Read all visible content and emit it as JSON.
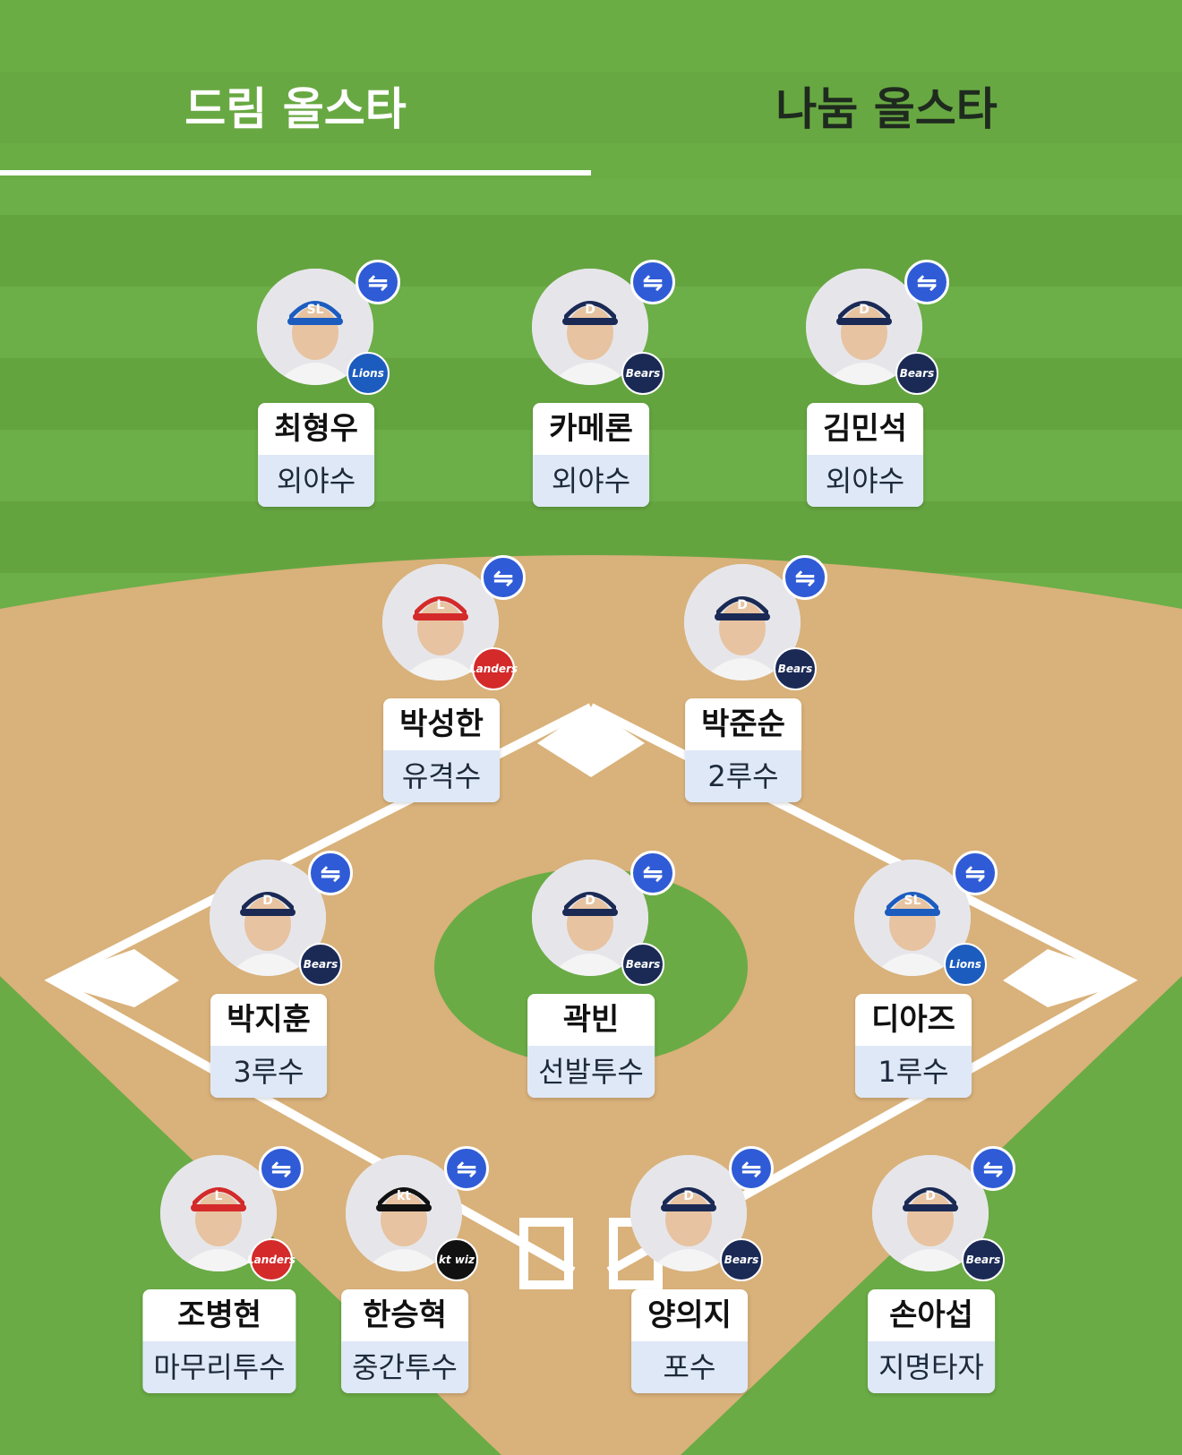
{
  "tabs": [
    {
      "label": "드림 올스타",
      "active": true
    },
    {
      "label": "나눔 올스타",
      "active": false
    }
  ],
  "colors": {
    "grass": "#6aab45",
    "dirt": "#d9b17a",
    "swap": "#2f5bd6",
    "position_bg": "#dfe8f6"
  },
  "teams": {
    "lions": {
      "text": "Lions",
      "color": "#1d5cbf"
    },
    "bears": {
      "text": "Bears",
      "color": "#1b2a55"
    },
    "landers": {
      "text": "Landers",
      "color": "#d42a2a"
    },
    "ktwiz": {
      "text": "kt wiz",
      "color": "#111111"
    }
  },
  "players": [
    {
      "id": "p1",
      "name": "최형우",
      "position": "외야수",
      "team": "lions",
      "cap": "SL"
    },
    {
      "id": "p2",
      "name": "카메론",
      "position": "외야수",
      "team": "bears",
      "cap": "D"
    },
    {
      "id": "p3",
      "name": "김민석",
      "position": "외야수",
      "team": "bears",
      "cap": "D"
    },
    {
      "id": "p4",
      "name": "박성한",
      "position": "유격수",
      "team": "landers",
      "cap": "L"
    },
    {
      "id": "p5",
      "name": "박준순",
      "position": "2루수",
      "team": "bears",
      "cap": "D"
    },
    {
      "id": "p6",
      "name": "박지훈",
      "position": "3루수",
      "team": "bears",
      "cap": "D"
    },
    {
      "id": "p7",
      "name": "곽빈",
      "position": "선발투수",
      "team": "bears",
      "cap": "D"
    },
    {
      "id": "p8",
      "name": "디아즈",
      "position": "1루수",
      "team": "lions",
      "cap": "SL"
    },
    {
      "id": "p9",
      "name": "조병현",
      "position": "마무리투수",
      "team": "landers",
      "cap": "L"
    },
    {
      "id": "p10",
      "name": "한승혁",
      "position": "중간투수",
      "team": "ktwiz",
      "cap": "kt"
    },
    {
      "id": "p11",
      "name": "양의지",
      "position": "포수",
      "team": "bears",
      "cap": "D"
    },
    {
      "id": "p12",
      "name": "손아섭",
      "position": "지명타자",
      "team": "bears",
      "cap": "D"
    }
  ],
  "icons": {
    "swap": "⇋"
  }
}
